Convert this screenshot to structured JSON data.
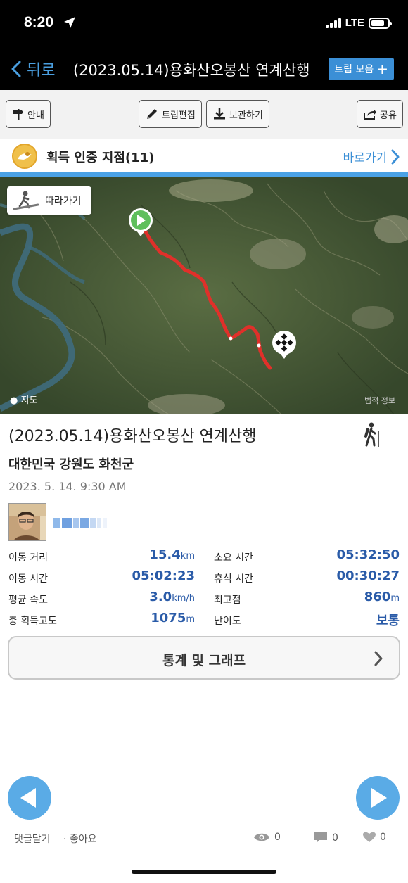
{
  "status": {
    "time": "8:20",
    "network": "LTE"
  },
  "nav": {
    "back_label": "뒤로",
    "title": "(2023.05.14)용화산오봉산 연계산행",
    "collect_label": "트립 모음",
    "collect_plus": "+"
  },
  "toolbar": {
    "guide_label": "안내",
    "edit_label": "트립편집",
    "save_label": "보관하기",
    "share_label": "공유"
  },
  "cert": {
    "label": "획득 인증 지점(11)",
    "goto_label": "바로가기"
  },
  "map": {
    "follow_label": "따라가기",
    "brand": "지도",
    "legal": "법적 정보"
  },
  "trip": {
    "title": "(2023.05.14)용화산오봉산 연계산행",
    "region": "대한민국 강원도 화천군",
    "date": "2023. 5. 14. 9:30 AM"
  },
  "stats": [
    {
      "left_label": "이동 거리",
      "left_value": "15.4",
      "left_unit": "km",
      "right_label": "소요 시간",
      "right_value": "05:32:50",
      "right_unit": ""
    },
    {
      "left_label": "이동 시간",
      "left_value": "05:02:23",
      "left_unit": "",
      "right_label": "휴식 시간",
      "right_value": "00:30:27",
      "right_unit": ""
    },
    {
      "left_label": "평균 속도",
      "left_value": "3.0",
      "left_unit": "km/h",
      "right_label": "최고점",
      "right_value": "860",
      "right_unit": "m"
    },
    {
      "left_label": "총 획득고도",
      "left_value": "1075",
      "left_unit": "m",
      "right_label": "난이도",
      "right_value": "보통",
      "right_unit": ""
    }
  ],
  "graph_button": "통계 및 그래프",
  "footer": {
    "comment_label": "댓글달기",
    "like_label": "· 좋아요",
    "views": "0",
    "comments": "0",
    "likes": "0"
  },
  "colors": {
    "accent": "#3b8fd6",
    "value_blue": "#2a5ba8",
    "route_red": "#e0302a",
    "nav_circle": "#5aabe6"
  }
}
